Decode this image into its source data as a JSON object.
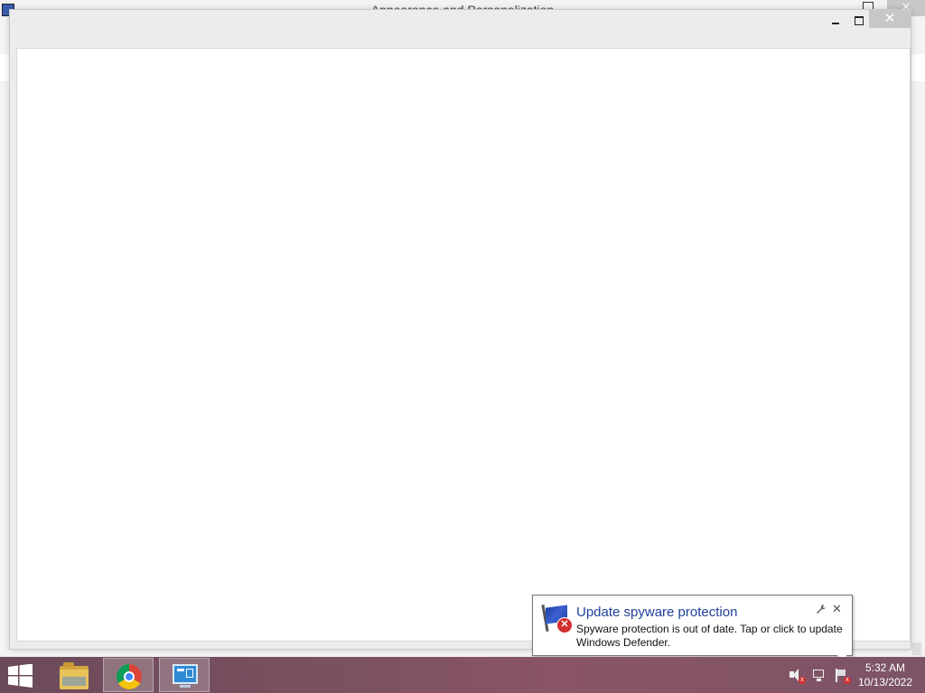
{
  "background_window": {
    "title": "Appearance and Personalization",
    "close_glyph": "✕"
  },
  "main_window": {
    "close_glyph": "✕"
  },
  "taskbar": {
    "apps": [
      {
        "name": "File Explorer",
        "icon": "folder-icon"
      },
      {
        "name": "Google Chrome",
        "icon": "chrome-icon"
      },
      {
        "name": "Control Panel",
        "icon": "control-panel-icon",
        "active": true
      }
    ],
    "tray": [
      "volume-muted-icon",
      "network-icon",
      "action-center-flag-icon"
    ],
    "clock": {
      "time": "5:32 AM",
      "date": "10/13/2022"
    }
  },
  "notification": {
    "title": "Update spyware protection",
    "body": "Spyware protection is out of date. Tap or click to update Windows Defender.",
    "settings_glyph": "🔧",
    "close_glyph": "✕",
    "error_glyph": "✕"
  },
  "colors": {
    "notification_title": "#1f3f9a",
    "taskbar": "#7a5161"
  }
}
